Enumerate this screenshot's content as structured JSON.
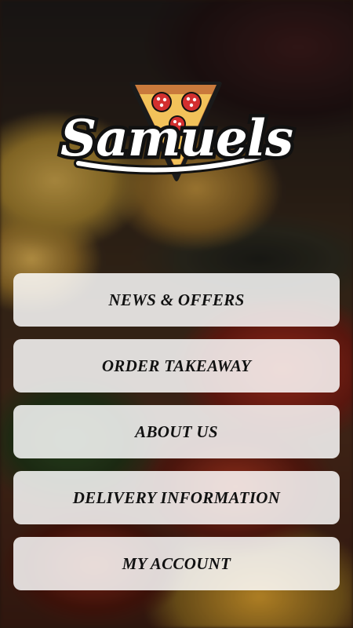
{
  "brand": {
    "name": "Samuels",
    "icon": "pizza-slice-icon",
    "colors": {
      "crust": "#c97a3c",
      "pepperoni": "#d32f2f",
      "text": "#ffffff",
      "outline": "#000000"
    }
  },
  "menu": {
    "items": [
      {
        "label": "NEWS & OFFERS"
      },
      {
        "label": "ORDER TAKEAWAY"
      },
      {
        "label": "ABOUT US"
      },
      {
        "label": "DELIVERY INFORMATION"
      },
      {
        "label": "MY ACCOUNT"
      }
    ]
  }
}
